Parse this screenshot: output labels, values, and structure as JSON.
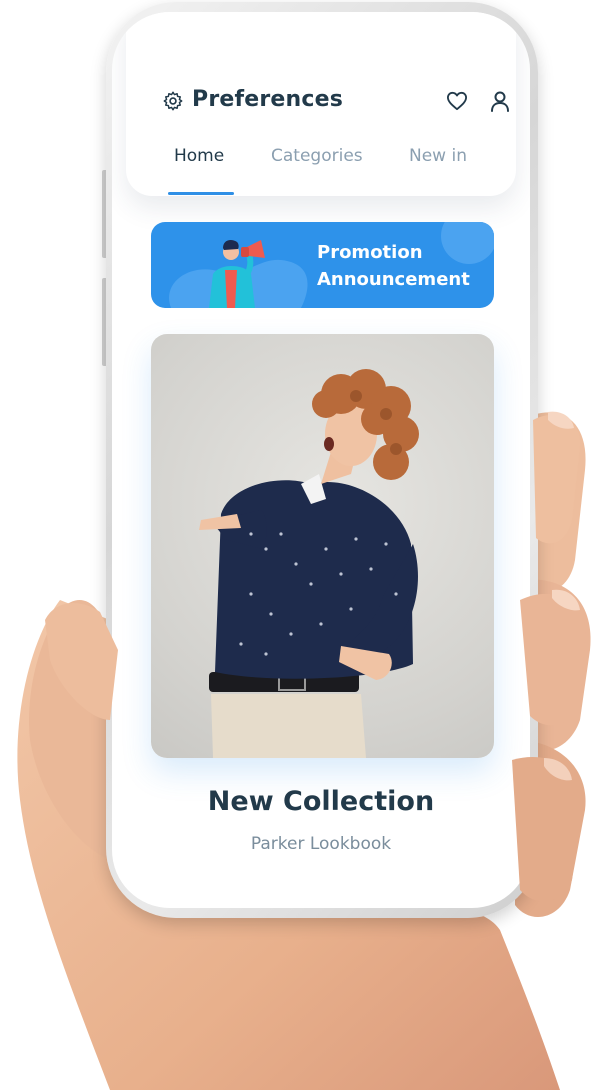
{
  "header": {
    "title": "Preferences",
    "tabs": [
      {
        "label": "Home",
        "active": true
      },
      {
        "label": "Categories",
        "active": false
      },
      {
        "label": "New in",
        "active": false
      }
    ],
    "icons": [
      "gear-icon",
      "heart-icon",
      "user-icon"
    ]
  },
  "promo": {
    "line1": "Promotion",
    "line2": "Announcement"
  },
  "collection": {
    "title": "New Collection",
    "subtitle": "Parker Lookbook"
  },
  "colors": {
    "accent": "#2e92ea",
    "text_dark": "#223a4a",
    "text_muted": "#8b9fb0"
  }
}
